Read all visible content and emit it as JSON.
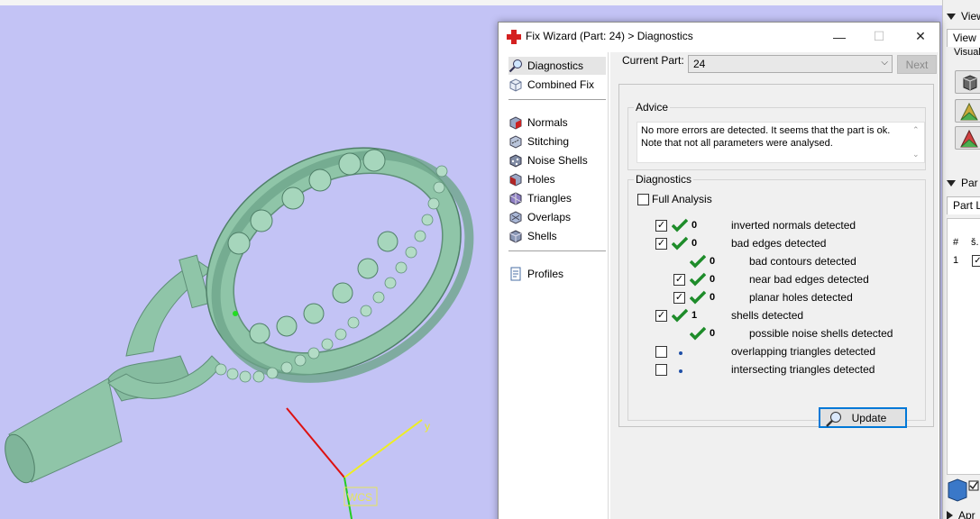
{
  "viewport": {
    "axis_y_label": "y",
    "wcs_label": "WCS",
    "colors": {
      "background": "#c3c3f5",
      "model": "#8fc5a8",
      "model_dark": "#5f8f78",
      "axis_x": "#dd1111",
      "axis_y": "#eeee22",
      "axis_z": "#22cc22"
    }
  },
  "right_panel": {
    "view_header": "View",
    "view_tab": "View",
    "visualization_label": "Visuali",
    "parts_header": "Par",
    "part_list_tab": "Part Lis",
    "table_header_hash": "#",
    "table_header_sel": "š.",
    "row_number": "1",
    "bottom_label": "Apr"
  },
  "dialog": {
    "title": "Fix Wizard (Part: 24) > Diagnostics",
    "minimize_glyph": "—",
    "maximize_glyph": "☐",
    "close_glyph": "✕",
    "nav": {
      "diagnostics": "Diagnostics",
      "combined_fix": "Combined Fix",
      "normals": "Normals",
      "stitching": "Stitching",
      "noise_shells": "Noise Shells",
      "holes": "Holes",
      "triangles": "Triangles",
      "overlaps": "Overlaps",
      "shells": "Shells",
      "profiles": "Profiles"
    },
    "current_part_label": "Current Part:",
    "current_part_value": "24",
    "next_button": "Next",
    "advice": {
      "title": "Advice",
      "line1": "No more errors are detected. It seems that the part is ok.",
      "line2": "Note that not all parameters were analysed."
    },
    "diagnostics": {
      "title": "Diagnostics",
      "full_analysis": "Full Analysis",
      "full_analysis_checked": false,
      "rows": [
        {
          "count": "0",
          "label": "inverted normals detected",
          "checked": true
        },
        {
          "count": "0",
          "label": "bad edges detected",
          "checked": true
        },
        {
          "count": "0",
          "label": "bad contours detected"
        },
        {
          "count": "0",
          "label": "near bad edges detected",
          "checked": true
        },
        {
          "count": "0",
          "label": "planar holes detected",
          "checked": true
        },
        {
          "count": "1",
          "label": "shells detected",
          "checked": true
        },
        {
          "count": "0",
          "label": "possible noise shells detected"
        },
        {
          "count": "",
          "label": "overlapping triangles detected",
          "checked": false
        },
        {
          "count": "",
          "label": "intersecting triangles detected",
          "checked": false
        }
      ]
    },
    "update_button": "Update",
    "accent_color": "#0078d7",
    "check_color": "#1e8c2a"
  }
}
